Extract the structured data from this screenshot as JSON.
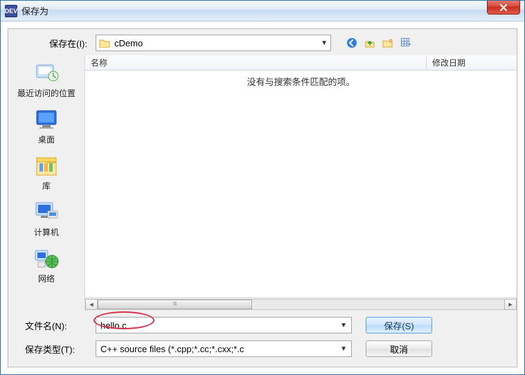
{
  "window": {
    "title": "保存为"
  },
  "topbar": {
    "save_in_label": "保存在(I):",
    "folder_name": "cDemo"
  },
  "places": {
    "recent": "最近访问的位置",
    "desktop": "桌面",
    "libraries": "库",
    "computer": "计算机",
    "network": "网络"
  },
  "list": {
    "col_name": "名称",
    "col_date": "修改日期",
    "empty_msg": "没有与搜索条件匹配的项。"
  },
  "bottom": {
    "filename_label": "文件名(N):",
    "filename_value": "hello.c",
    "filetype_label": "保存类型(T):",
    "filetype_value": "C++ source files (*.cpp;*.cc;*.cxx;*.c",
    "save_btn": "保存(S)",
    "cancel_btn": "取消"
  }
}
